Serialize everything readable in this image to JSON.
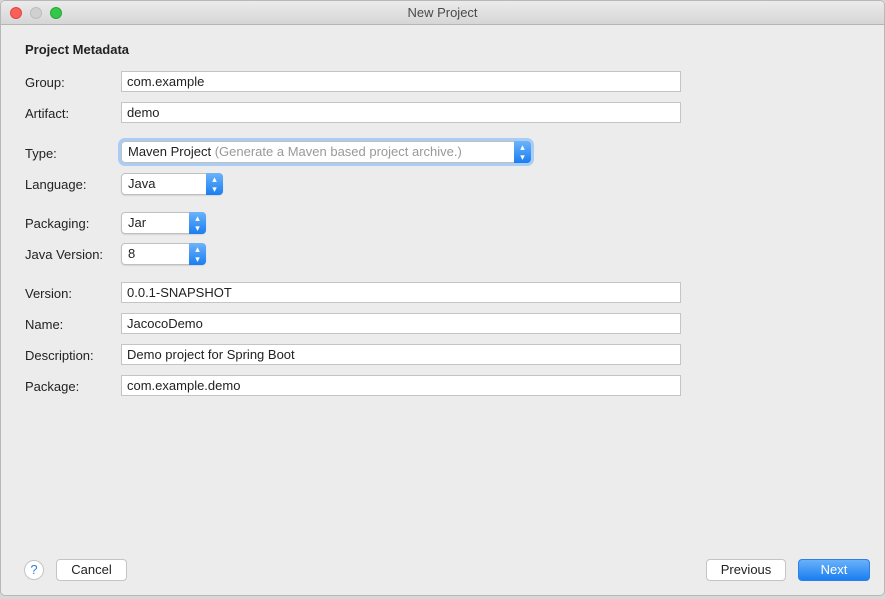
{
  "window": {
    "title": "New Project"
  },
  "section_title": "Project Metadata",
  "fields": {
    "group": {
      "label": "Group:",
      "value": "com.example"
    },
    "artifact": {
      "label": "Artifact:",
      "value": "demo"
    },
    "type": {
      "label": "Type:",
      "value": "Maven Project",
      "hint": "(Generate a Maven based project archive.)"
    },
    "language": {
      "label": "Language:",
      "value": "Java"
    },
    "packaging": {
      "label": "Packaging:",
      "value": "Jar"
    },
    "java_version": {
      "label": "Java Version:",
      "value": "8"
    },
    "version": {
      "label": "Version:",
      "value": "0.0.1-SNAPSHOT"
    },
    "name": {
      "label": "Name:",
      "value": "JacocoDemo"
    },
    "description": {
      "label": "Description:",
      "value": "Demo project for Spring Boot"
    },
    "package": {
      "label": "Package:",
      "value": "com.example.demo"
    }
  },
  "footer": {
    "help": "?",
    "cancel": "Cancel",
    "previous": "Previous",
    "next": "Next"
  },
  "colors": {
    "accent": "#1a7ef1"
  }
}
